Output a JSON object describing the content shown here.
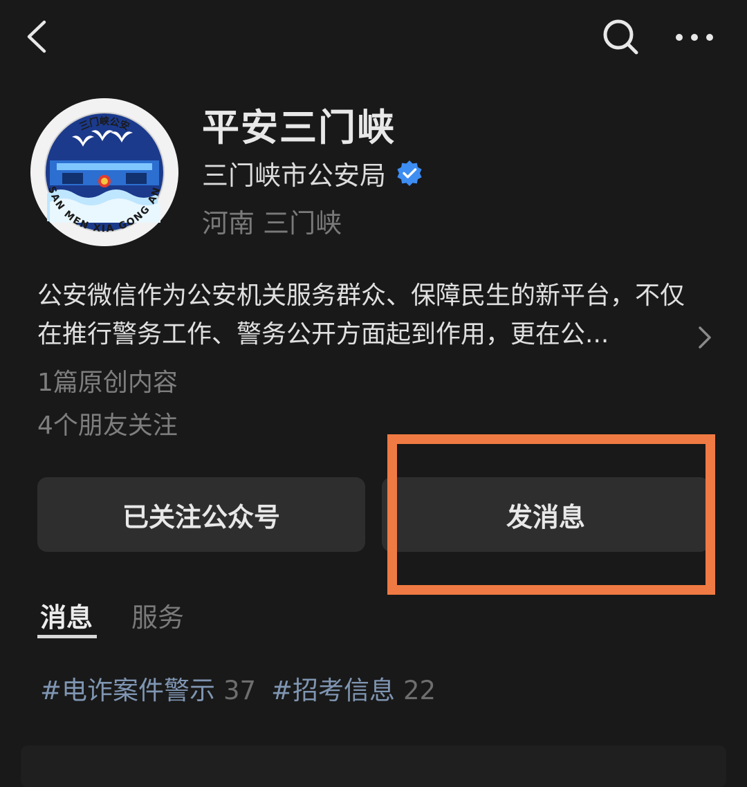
{
  "topbar": {
    "back_icon": "chevron-left-icon",
    "search_icon": "search-icon",
    "more_icon": "more-horizontal-icon"
  },
  "profile": {
    "avatar_icon": "sanmenxia-police-emblem",
    "avatar_logo_text": {
      "chinese": "三门峡公安",
      "pinyin": "SAN MEN XIA GONG AN"
    },
    "account_name": "平安三门峡",
    "organization": "三门峡市公安局",
    "verified_icon": "verified-badge-icon",
    "location": "河南 三门峡"
  },
  "description": "公安微信作为公安机关服务群众、保障民生的新平台，不仅在推行警务工作、警务公开方面起到作用，更在公...",
  "stats": {
    "original_content": "1篇原创内容",
    "friends_following": "4个朋友关注"
  },
  "buttons": {
    "follow_label": "已关注公众号",
    "message_label": "发消息"
  },
  "tabs": [
    {
      "label": "消息",
      "active": true
    },
    {
      "label": "服务",
      "active": false
    }
  ],
  "hashtags": [
    {
      "name": "#电诈案件警示",
      "count": "37"
    },
    {
      "name": "#招考信息",
      "count": "22"
    }
  ],
  "colors": {
    "background": "#191919",
    "button_bg": "#2e2e2e",
    "highlight": "#f07a43",
    "hashtag": "#7f95b2",
    "verified": "#3d8df2"
  }
}
